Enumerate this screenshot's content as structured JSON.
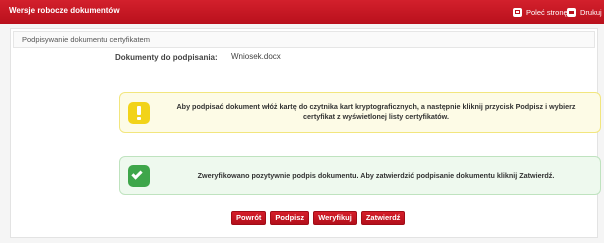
{
  "header": {
    "title": "Wersje robocze dokumentów",
    "share_label": "Poleć stronę",
    "share_icon": "share-icon",
    "print_label": "Drukuj",
    "print_icon": "printer-icon",
    "accent_color": "#c8141f"
  },
  "section": {
    "title": "Podpisywanie dokumentu certyfikatem"
  },
  "documents": {
    "label": "Dokumenty do podpisania:",
    "value": "Wniosek.docx"
  },
  "alerts": {
    "warning": {
      "icon": "exclamation-icon",
      "text": "Aby podpisać dokument włóż kartę do czytnika kart kryptograficznych, a następnie kliknij przycisk Podpisz i wybierz certyfikat z wyświetlonej listy certyfikatów.",
      "color": "#f2d319"
    },
    "success": {
      "icon": "checkmark-icon",
      "text": "Zweryfikowano pozytywnie podpis dokumentu. Aby zatwierdzić podpisanie dokumentu kliknij Zatwierdź.",
      "color": "#3ea64a"
    }
  },
  "actions": {
    "back_label": "Powrót",
    "sign_label": "Podpisz",
    "verify_label": "Weryfikuj",
    "confirm_label": "Zatwierdź"
  }
}
